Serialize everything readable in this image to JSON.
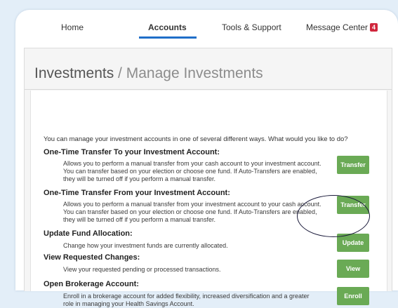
{
  "nav": {
    "home": "Home",
    "accounts": "Accounts",
    "tools": "Tools & Support",
    "messages": "Message Center",
    "message_count": "4"
  },
  "page": {
    "title": "Investments",
    "separator": " / ",
    "subtitle": "Manage Investments",
    "intro": "You can manage your investment accounts in one of several different ways. What would you like to do?"
  },
  "sections": [
    {
      "title": "One-Time Transfer To your Investment Account:",
      "description": "Allows you to perform a manual transfer from your cash account to your investment account. You can transfer based on your election or choose one fund. If Auto-Transfers are enabled, they will be turned off if you perform a manual transfer.",
      "button": "Transfer"
    },
    {
      "title": "One-Time Transfer From your Investment Account:",
      "description": "Allows you to perform a manual transfer from your investment account to your cash account. You can transfer based on your election or choose one fund. If Auto-Transfers are enabled, they will be turned off if you perform a manual transfer.",
      "button": "Transfer"
    },
    {
      "title": "Update Fund Allocation:",
      "description": "Change how your investment funds are currently allocated.",
      "button": "Update"
    },
    {
      "title": "View Requested Changes:",
      "description": "View your requested pending or processed transactions.",
      "button": "View"
    },
    {
      "title": "Open Brokerage Account:",
      "description": "Enroll in a brokerage account for added flexibility, increased diversification and a greater role in managing your Health Savings Account.",
      "button": "Enroll"
    }
  ],
  "colors": {
    "button_green": "#6aaa55",
    "nav_active_underline": "#1f6ec8",
    "badge_red": "#d0263c"
  }
}
